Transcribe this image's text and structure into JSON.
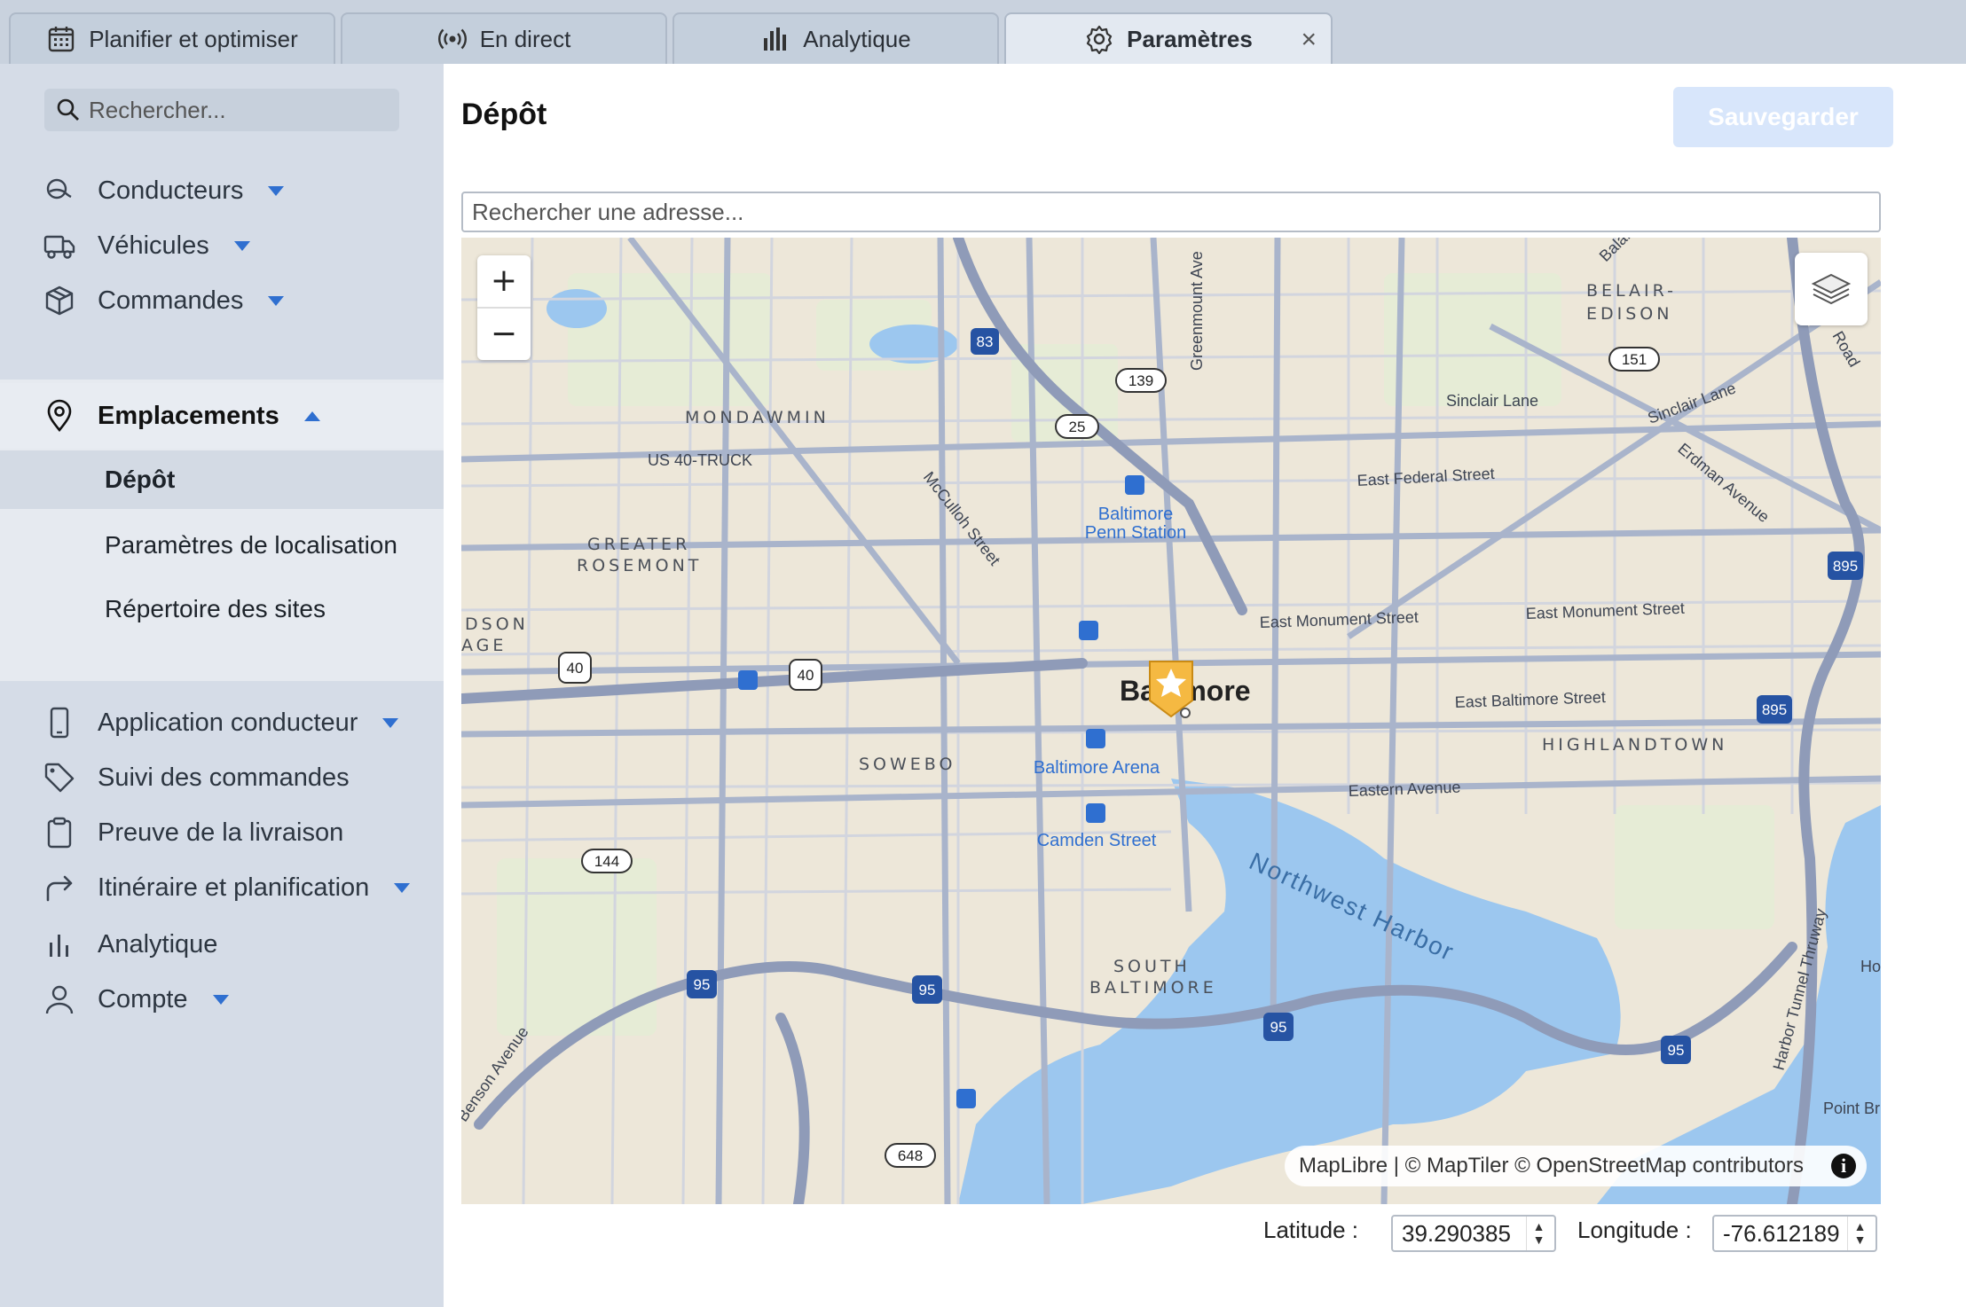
{
  "tabs": [
    {
      "label": "Planifier et optimiser",
      "icon": "calendar-icon"
    },
    {
      "label": "En direct",
      "icon": "broadcast-icon"
    },
    {
      "label": "Analytique",
      "icon": "bar-chart-icon"
    },
    {
      "label": "Paramètres",
      "icon": "gear-icon",
      "active": true,
      "close": "×"
    }
  ],
  "sidebar": {
    "search_placeholder": "Rechercher...",
    "items": [
      {
        "label": "Conducteurs",
        "icon": "drivers-icon"
      },
      {
        "label": "Véhicules",
        "icon": "truck-icon"
      },
      {
        "label": "Commandes",
        "icon": "box-icon"
      },
      {
        "label": "Emplacements",
        "icon": "location-pin-icon"
      },
      {
        "label": "Application conducteur",
        "icon": "phone-icon"
      },
      {
        "label": "Suivi des commandes",
        "icon": "tag-icon"
      },
      {
        "label": "Preuve de la livraison",
        "icon": "clipboard-icon"
      },
      {
        "label": "Itinéraire et planification",
        "icon": "route-icon"
      },
      {
        "label": "Analytique",
        "icon": "bar-chart-icon"
      },
      {
        "label": "Compte",
        "icon": "user-icon"
      }
    ],
    "subitems": [
      {
        "label": "Dépôt",
        "selected": true
      },
      {
        "label": "Paramètres de localisation"
      },
      {
        "label": "Répertoire des sites"
      }
    ]
  },
  "main": {
    "title": "Dépôt",
    "save_label": "Sauvegarder",
    "address_placeholder": "Rechercher une adresse...",
    "latitude_label": "Latitude :",
    "latitude_value": "39.290385",
    "longitude_label": "Longitude :",
    "longitude_value": "-76.612189"
  },
  "map": {
    "attribution": "MapLibre | © MapTiler © OpenStreetMap contributors",
    "zoom_in": "+",
    "zoom_out": "−",
    "info": "i",
    "city_label": "Baltimore",
    "neighborhoods": [
      "MONDAWMIN",
      "GREATER",
      "ROSEMONT",
      "SOWEBO",
      "SOUTH",
      "BALTIMORE",
      "HIGHLANDTOWN",
      "BELAIR-",
      "EDISON",
      "DSON",
      "AGE"
    ],
    "streets": [
      "US 40-TRUCK",
      "McCulloh Street",
      "Greenmount Ave",
      "Sinclair Lane",
      "Erdman Avenue",
      "East Federal Street",
      "East Monument Street",
      "East Baltimore Street",
      "Eastern Avenue",
      "Northwest Harbor",
      "Harbor Tunnel Thruway",
      "Benson Avenue",
      "Balai",
      "Road",
      "Ho",
      "Point Br"
    ],
    "stations": [
      "Baltimore",
      "Penn Station",
      "Baltimore Arena",
      "Camden Street"
    ],
    "shields": [
      "83",
      "139",
      "25",
      "151",
      "895",
      "895",
      "40",
      "40",
      "144",
      "95",
      "95",
      "95",
      "95",
      "648"
    ],
    "colors": {
      "water": "#9cc7ef",
      "land": "#ede7d9",
      "road": "#a9b4cb",
      "major_road": "#8f9bb8",
      "marker": "#f5b942",
      "station": "#2f6fd0"
    }
  },
  "colors": {
    "accent": "#2f6fd0",
    "save_disabled": "#d8e6fb"
  }
}
